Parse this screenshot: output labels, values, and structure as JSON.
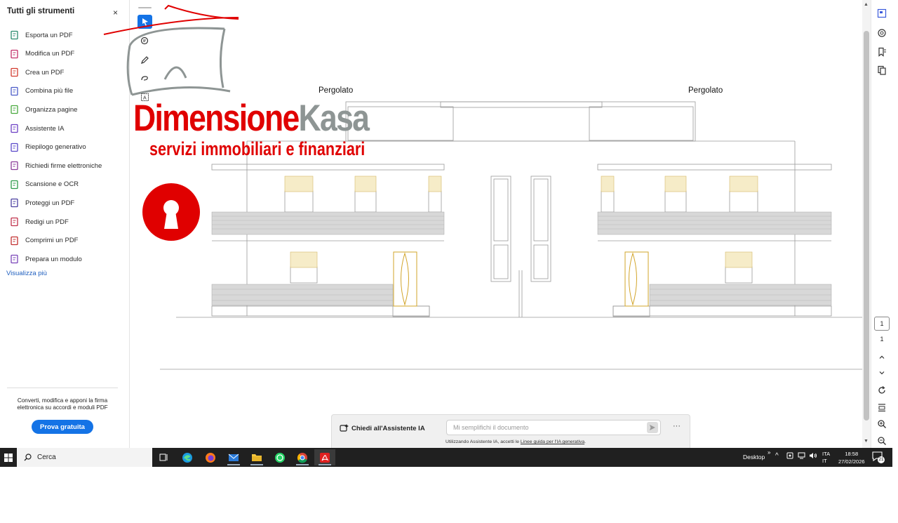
{
  "left_panel": {
    "title": "Tutti gli strumenti",
    "close_label": "×",
    "tools": [
      {
        "label": "Esporta un PDF",
        "icon": "export-pdf-icon",
        "color": "#2a8a6e"
      },
      {
        "label": "Modifica un PDF",
        "icon": "edit-pdf-icon",
        "color": "#c2306a"
      },
      {
        "label": "Crea un PDF",
        "icon": "create-pdf-icon",
        "color": "#d23a2e"
      },
      {
        "label": "Combina più file",
        "icon": "combine-files-icon",
        "color": "#4a5bc8"
      },
      {
        "label": "Organizza pagine",
        "icon": "organize-pages-icon",
        "color": "#48a83e"
      },
      {
        "label": "Assistente IA",
        "icon": "ai-assistant-icon",
        "color": "#6b3fc4"
      },
      {
        "label": "Riepilogo generativo",
        "icon": "generative-summary-icon",
        "color": "#5a48c9"
      },
      {
        "label": "Richiedi firme elettroniche",
        "icon": "request-signatures-icon",
        "color": "#8a3c98"
      },
      {
        "label": "Scansione e OCR",
        "icon": "scan-ocr-icon",
        "color": "#2d9a4a"
      },
      {
        "label": "Proteggi un PDF",
        "icon": "protect-pdf-icon",
        "color": "#4a3fa0"
      },
      {
        "label": "Redigi un PDF",
        "icon": "redact-pdf-icon",
        "color": "#c0304a"
      },
      {
        "label": "Comprimi un PDF",
        "icon": "compress-pdf-icon",
        "color": "#c23030"
      },
      {
        "label": "Prepara un modulo",
        "icon": "prepare-form-icon",
        "color": "#7a44b8"
      }
    ],
    "see_more": "Visualizza più",
    "promo_text": "Converti, modifica e apponi la firma elettronica su accordi e moduli PDF",
    "promo_button": "Prova gratuita"
  },
  "vertical_toolbar": {
    "tools": [
      "select-arrow-icon",
      "comment-icon",
      "pen-icon",
      "freehand-icon",
      "text-box-icon"
    ]
  },
  "drawing": {
    "label_left": "Pergolato",
    "label_right": "Pergolato"
  },
  "watermark": {
    "name_part1": "Dimensione",
    "name_part2": "Kasa",
    "subtitle": "servizi immobiliari e finanziari",
    "brand_red": "#e00000",
    "brand_gray": "#8e9594"
  },
  "right_rail": {
    "icons": [
      "edit-panel-icon",
      "link-icon",
      "bookmark-icon",
      "pages-icon"
    ],
    "page_current": "1",
    "page_total": "1",
    "bottom_icons": [
      "rotate-icon",
      "scroll-mode-icon",
      "zoom-in-icon",
      "zoom-out-icon"
    ]
  },
  "ai_bar": {
    "title": "Chiedi all'Assistente IA",
    "placeholder": "Mi semplifichi il documento",
    "note_prefix": "Utilizzando Assistente IA, accetti le ",
    "note_link": "Linee guida per l'IA generativa",
    "note_suffix": ".",
    "more_label": "···"
  },
  "taskbar": {
    "search_label": "Cerca",
    "apps": [
      "task-view-icon",
      "edge-icon",
      "firefox-icon",
      "mail-icon",
      "file-explorer-icon",
      "whatsapp-icon",
      "chrome-icon",
      "acrobat-icon"
    ],
    "desktop_label": "Desktop",
    "lang_line1": "ITA",
    "lang_line2": "IT",
    "time": "18:58",
    "date": "27/02/2026",
    "notifications": "21"
  }
}
